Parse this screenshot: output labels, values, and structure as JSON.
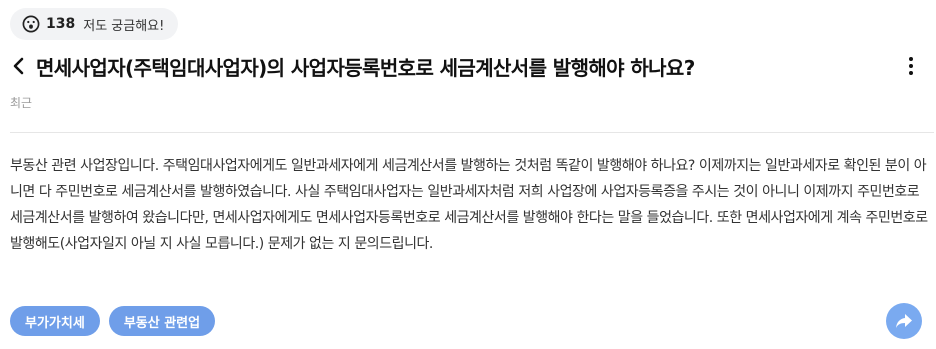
{
  "curious": {
    "icon": "surprised-face-icon",
    "count": "138",
    "label": "저도 궁금해요!"
  },
  "question": {
    "title": "면세사업자(주택임대사업자)의 사업자등록번호로 세금계산서를 발행해야 하나요?",
    "meta": "최근",
    "body": "부동산 관련 사업장입니다. 주택임대사업자에게도 일반과세자에게 세금계산서를 발행하는 것처럼 똑같이 발행해야 하나요? 이제까지는 일반과세자로 확인된 분이 아니면 다 주민번호로 세금계산서를 발행하였습니다. 사실 주택임대사업자는 일반과세자처럼 저희 사업장에 사업자등록증을 주시는 것이 아니니 이제까지 주민번호로 세금계산서를 발행하여 왔습니다만, 면세사업자에게도 면세사업자등록번호로 세금계산서를 발행해야 한다는 말을 들었습니다. 또한 면세사업자에게 계속 주민번호로 발행해도(사업자일지 아닐 지 사실 모릅니다.) 문제가 없는 지 문의드립니다."
  },
  "tags": [
    {
      "label": "부가가치세"
    },
    {
      "label": "부동산 관련업"
    }
  ],
  "icons": {
    "back": "chevron-left-icon",
    "more": "more-vertical-icon",
    "share": "share-arrow-icon"
  },
  "colors": {
    "tag_bg": "#6f9ee9",
    "share_bg": "#7aaaf0",
    "pill_bg": "#f2f3f5"
  }
}
